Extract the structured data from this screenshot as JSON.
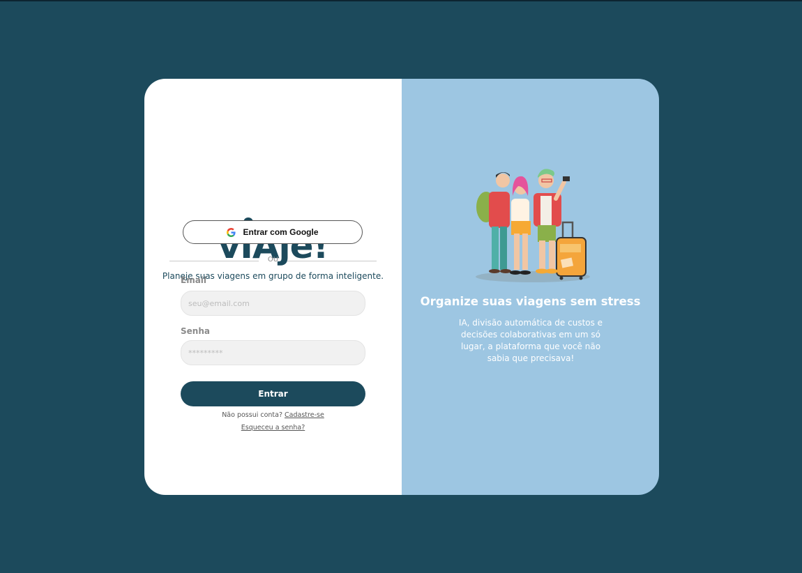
{
  "brand": {
    "logo_text": "vIAje!",
    "tagline": "Planeje suas viagens em grupo de forma inteligente.",
    "primary_color": "#1c4a5c",
    "accent_panel_color": "#9dc6e2"
  },
  "login": {
    "google_button_label": "Entrar com Google",
    "divider_text": "OU",
    "email_label": "Email",
    "email_placeholder": "seu@email.com",
    "password_label": "Senha",
    "password_placeholder": "*********",
    "submit_label": "Entrar",
    "no_account_text": "Não possui conta?",
    "signup_link": "Cadastre-se",
    "forgot_link": "Esqueceu a senha?"
  },
  "promo": {
    "title": "Organize suas viagens sem stress",
    "description": "IA, divisão automática de custos e decisões colaborativas em um só lugar, a plataforma que você não sabia que precisava!",
    "illustration": "travelers-selfie-with-suitcase"
  },
  "icons": {
    "google": "google-icon",
    "pin": "map-pin-icon"
  }
}
